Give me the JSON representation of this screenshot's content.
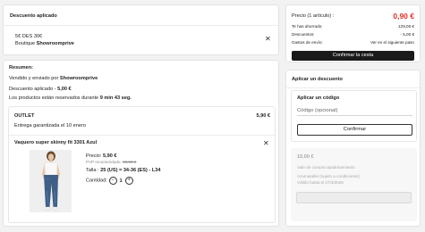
{
  "discount_card": {
    "title": "Descuento aplicado",
    "line1": "5€ DES 30€",
    "line2": "Boutique Showroomprive",
    "remove_icon": "close-icon"
  },
  "summary": {
    "title": "Resumen:",
    "sold_prefix": "Vendido y enviado por ",
    "sold_by": "Showroomprive",
    "discount_prefix": "Descuento aplicado - ",
    "discount_value": "5,00 €",
    "reserved_prefix": "Los productos están reservados durante ",
    "reserved_time": "9 min 43 seg."
  },
  "outlet": {
    "title": "OUTLET",
    "price": "5,90 €",
    "delivery": "Entrega garantizada el 10 enero"
  },
  "product": {
    "name": "Vaquero super skinny fit 3301 Azul",
    "price_label": "Precio: ",
    "price": "5,90 €",
    "pvp_label": "PVP recomendado: ",
    "pvp": "69,90 €",
    "size_label": "Talla : ",
    "size": "25 (US) = 34-36 (ES) - L34",
    "qty_label": "Cantidad:",
    "qty_minus": "−",
    "qty": "1",
    "qty_plus": "+",
    "remove_icon": "close-icon",
    "image_icon": "jeans-model-photo"
  },
  "price_card": {
    "title": "Precio (1 artículo) :",
    "total": "0,90 €",
    "rows": [
      {
        "label": "Te has ahorrado:",
        "value": "129,00 €"
      },
      {
        "label": "Descuentos:",
        "value": "- 5,00 €"
      },
      {
        "label": "Gastos de envío:",
        "value": "Ver en el siguiente paso"
      }
    ],
    "checkout_label": "Confirmar la cesta"
  },
  "apply_card": {
    "title": "Aplicar un descuento",
    "code_title": "Aplicar un código",
    "code_placeholder": "Código (opcional)",
    "confirm_label": "Confirmar",
    "voucher": {
      "amount": "15,00 €",
      "line1": "Vale de compra apadrinamiento",
      "line2": "Acumulable (sujeto a condiciones)",
      "line3": "Válido hasta el 27/3/2026"
    }
  },
  "colors": {
    "accent_red": "#e0312b",
    "checkout_bg": "#1a1a1a",
    "page_bg": "#f2f2f2"
  }
}
